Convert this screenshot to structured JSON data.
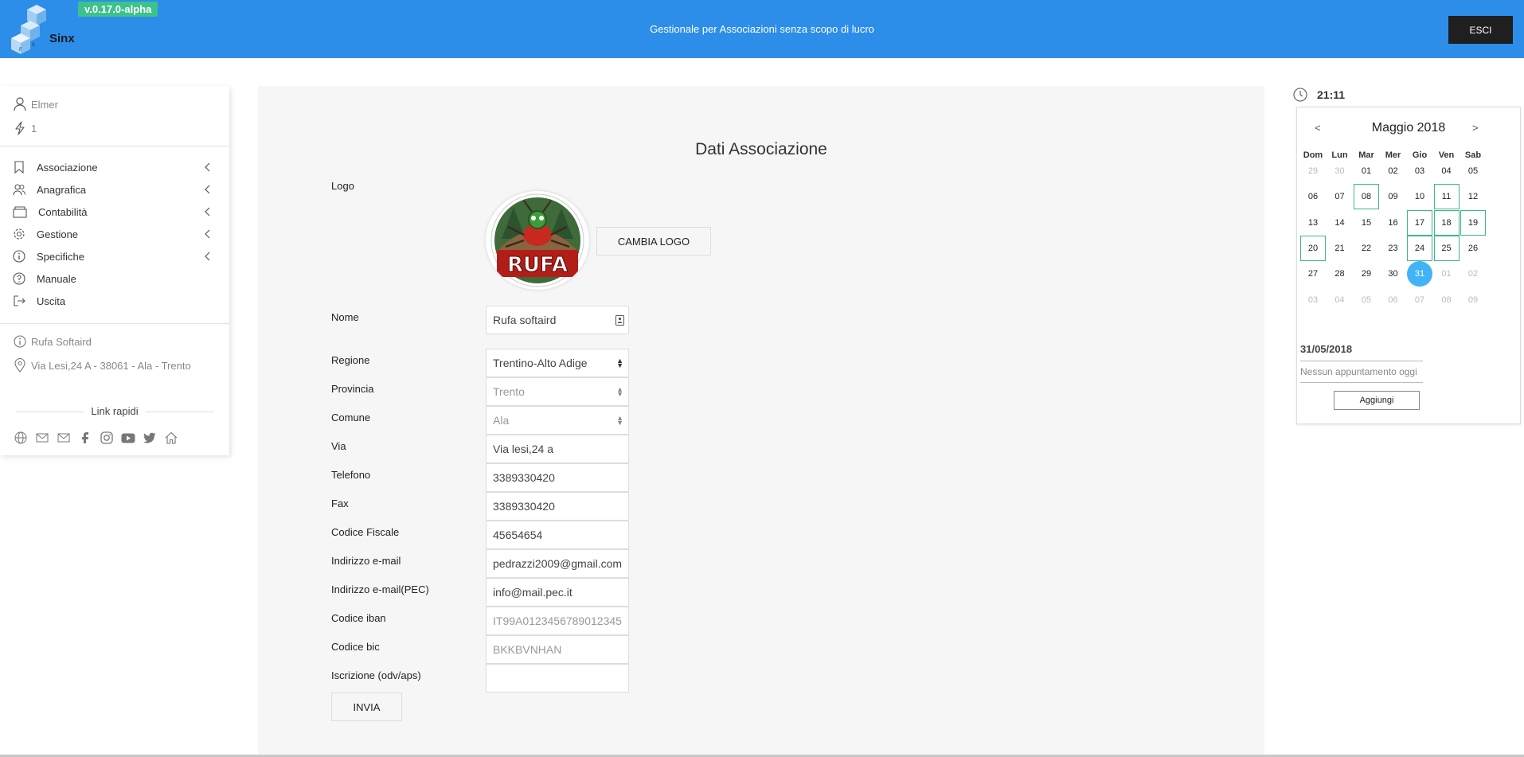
{
  "header": {
    "logo_text": "Sinx",
    "version": "v.0.17.0-alpha",
    "subtitle": "Gestionale per Associazioni senza scopo di lucro",
    "logout_label": "ESCI"
  },
  "sidebar": {
    "user_name": "Elmer",
    "user_level": "1",
    "menu": [
      {
        "label": "Associazione",
        "icon": "bookmark-icon"
      },
      {
        "label": "Anagrafica",
        "icon": "users-icon"
      },
      {
        "label": "Contabilità",
        "icon": "wallet-icon"
      },
      {
        "label": "Gestione",
        "icon": "gear-icon"
      },
      {
        "label": "Specifiche",
        "icon": "info-icon"
      },
      {
        "label": "Manuale",
        "icon": "help-icon"
      },
      {
        "label": "Uscita",
        "icon": "exit-icon"
      }
    ],
    "assoc_name": "Rufa Softaird",
    "assoc_address": "Via Lesi,24 A - 38061 - Ala - Trento",
    "quick_links_label": "Link rapidi",
    "social_icons": [
      "globe-icon",
      "mail-icon",
      "mail-alt-icon",
      "facebook-icon",
      "instagram-icon",
      "youtube-icon",
      "twitter-icon",
      "home-icon"
    ]
  },
  "form": {
    "title": "Dati Associazione",
    "logo_label": "Logo",
    "logo_text": "RUFA",
    "change_logo_label": "CAMBIA LOGO",
    "nome": {
      "label": "Nome",
      "value": "Rufa softaird"
    },
    "regione": {
      "label": "Regione",
      "value": "Trentino-Alto Adige"
    },
    "provincia": {
      "label": "Provincia",
      "value": "Trento"
    },
    "comune": {
      "label": "Comune",
      "value": "Ala"
    },
    "via": {
      "label": "Via",
      "value": "Via lesi,24 a"
    },
    "telefono": {
      "label": "Telefono",
      "value": "3389330420"
    },
    "fax": {
      "label": "Fax",
      "value": "3389330420"
    },
    "codice_fiscale": {
      "label": "Codice Fiscale",
      "value": "45654654"
    },
    "email": {
      "label": "Indirizzo e-mail",
      "value": "pedrazzi2009@gmail.com"
    },
    "pec": {
      "label": "Indirizzo e-mail(PEC)",
      "value": "info@mail.pec.it"
    },
    "iban": {
      "label": "Codice iban",
      "placeholder": "IT99A0123456789012345"
    },
    "bic": {
      "label": "Codice bic",
      "placeholder": "BKKBVNHAN"
    },
    "iscrizione": {
      "label": "Iscrizione (odv/aps)",
      "value": ""
    },
    "submit_label": "INVIA"
  },
  "widget": {
    "time": "21:11",
    "calendar": {
      "prev": "<",
      "next": ">",
      "month": "Maggio 2018",
      "weekdays": [
        "Dom",
        "Lun",
        "Mar",
        "Mer",
        "Gio",
        "Ven",
        "Sab"
      ],
      "weeks": [
        [
          "29",
          "30",
          "01",
          "02",
          "03",
          "04",
          "05"
        ],
        [
          "06",
          "07",
          "08",
          "09",
          "10",
          "11",
          "12"
        ],
        [
          "13",
          "14",
          "15",
          "16",
          "17",
          "18",
          "19"
        ],
        [
          "20",
          "21",
          "22",
          "23",
          "24",
          "25",
          "26"
        ],
        [
          "27",
          "28",
          "29",
          "30",
          "31",
          "01",
          "02"
        ],
        [
          "03",
          "04",
          "05",
          "06",
          "07",
          "08",
          "09"
        ]
      ],
      "dimmed_cells": [
        "0-0",
        "0-1",
        "4-5",
        "4-6",
        "5-0",
        "5-1",
        "5-2",
        "5-3",
        "5-4",
        "5-5",
        "5-6"
      ],
      "marked_cells": [
        "1-2",
        "1-5",
        "2-4",
        "2-5",
        "2-6",
        "3-0",
        "3-4",
        "3-5"
      ],
      "selected_cell": "4-4",
      "selected_date": "31/05/2018",
      "no_appointments": "Nessun appuntamento oggi",
      "add_label": "Aggiungi"
    }
  },
  "colors": {
    "header_bg": "#2d8eea",
    "version_badge": "#3cc28a",
    "selected_day": "#42b3f5",
    "marked_day_border": "#3cb88a"
  }
}
